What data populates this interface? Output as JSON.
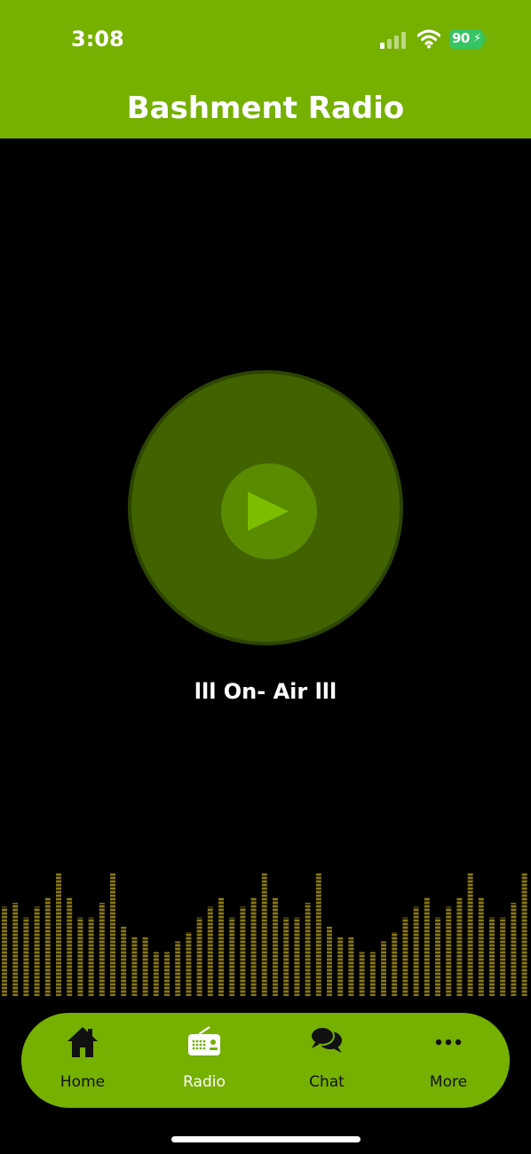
{
  "status_bar": {
    "time": "3:08",
    "battery": "90"
  },
  "header": {
    "title": "Bashment Radio"
  },
  "player": {
    "status": "lll  On- Air  lll"
  },
  "tabs": [
    {
      "label": "Home",
      "icon": "home-icon",
      "active": false
    },
    {
      "label": "Radio",
      "icon": "radio-icon",
      "active": true
    },
    {
      "label": "Chat",
      "icon": "chat-icon",
      "active": false
    },
    {
      "label": "More",
      "icon": "more-icon",
      "active": false
    }
  ],
  "colors": {
    "accent": "#76b000",
    "player_bg": "#406300",
    "play_button": "#5a8a00",
    "equalizer": "#8b7a10"
  },
  "equalizer_levels": [
    0.67,
    0.7,
    0.59,
    0.67,
    0.74,
    0.92,
    0.74,
    0.59,
    0.59,
    0.7,
    0.92,
    0.52,
    0.44,
    0.44,
    0.33,
    0.33,
    0.41,
    0.48,
    0.59,
    0.67,
    0.74,
    0.59,
    0.67,
    0.74,
    0.92,
    0.74,
    0.59,
    0.59,
    0.7,
    0.92,
    0.52,
    0.44,
    0.44,
    0.33,
    0.33,
    0.41,
    0.48,
    0.59,
    0.67,
    0.74,
    0.59,
    0.67,
    0.74,
    0.92,
    0.74,
    0.59,
    0.59,
    0.7,
    0.92
  ]
}
